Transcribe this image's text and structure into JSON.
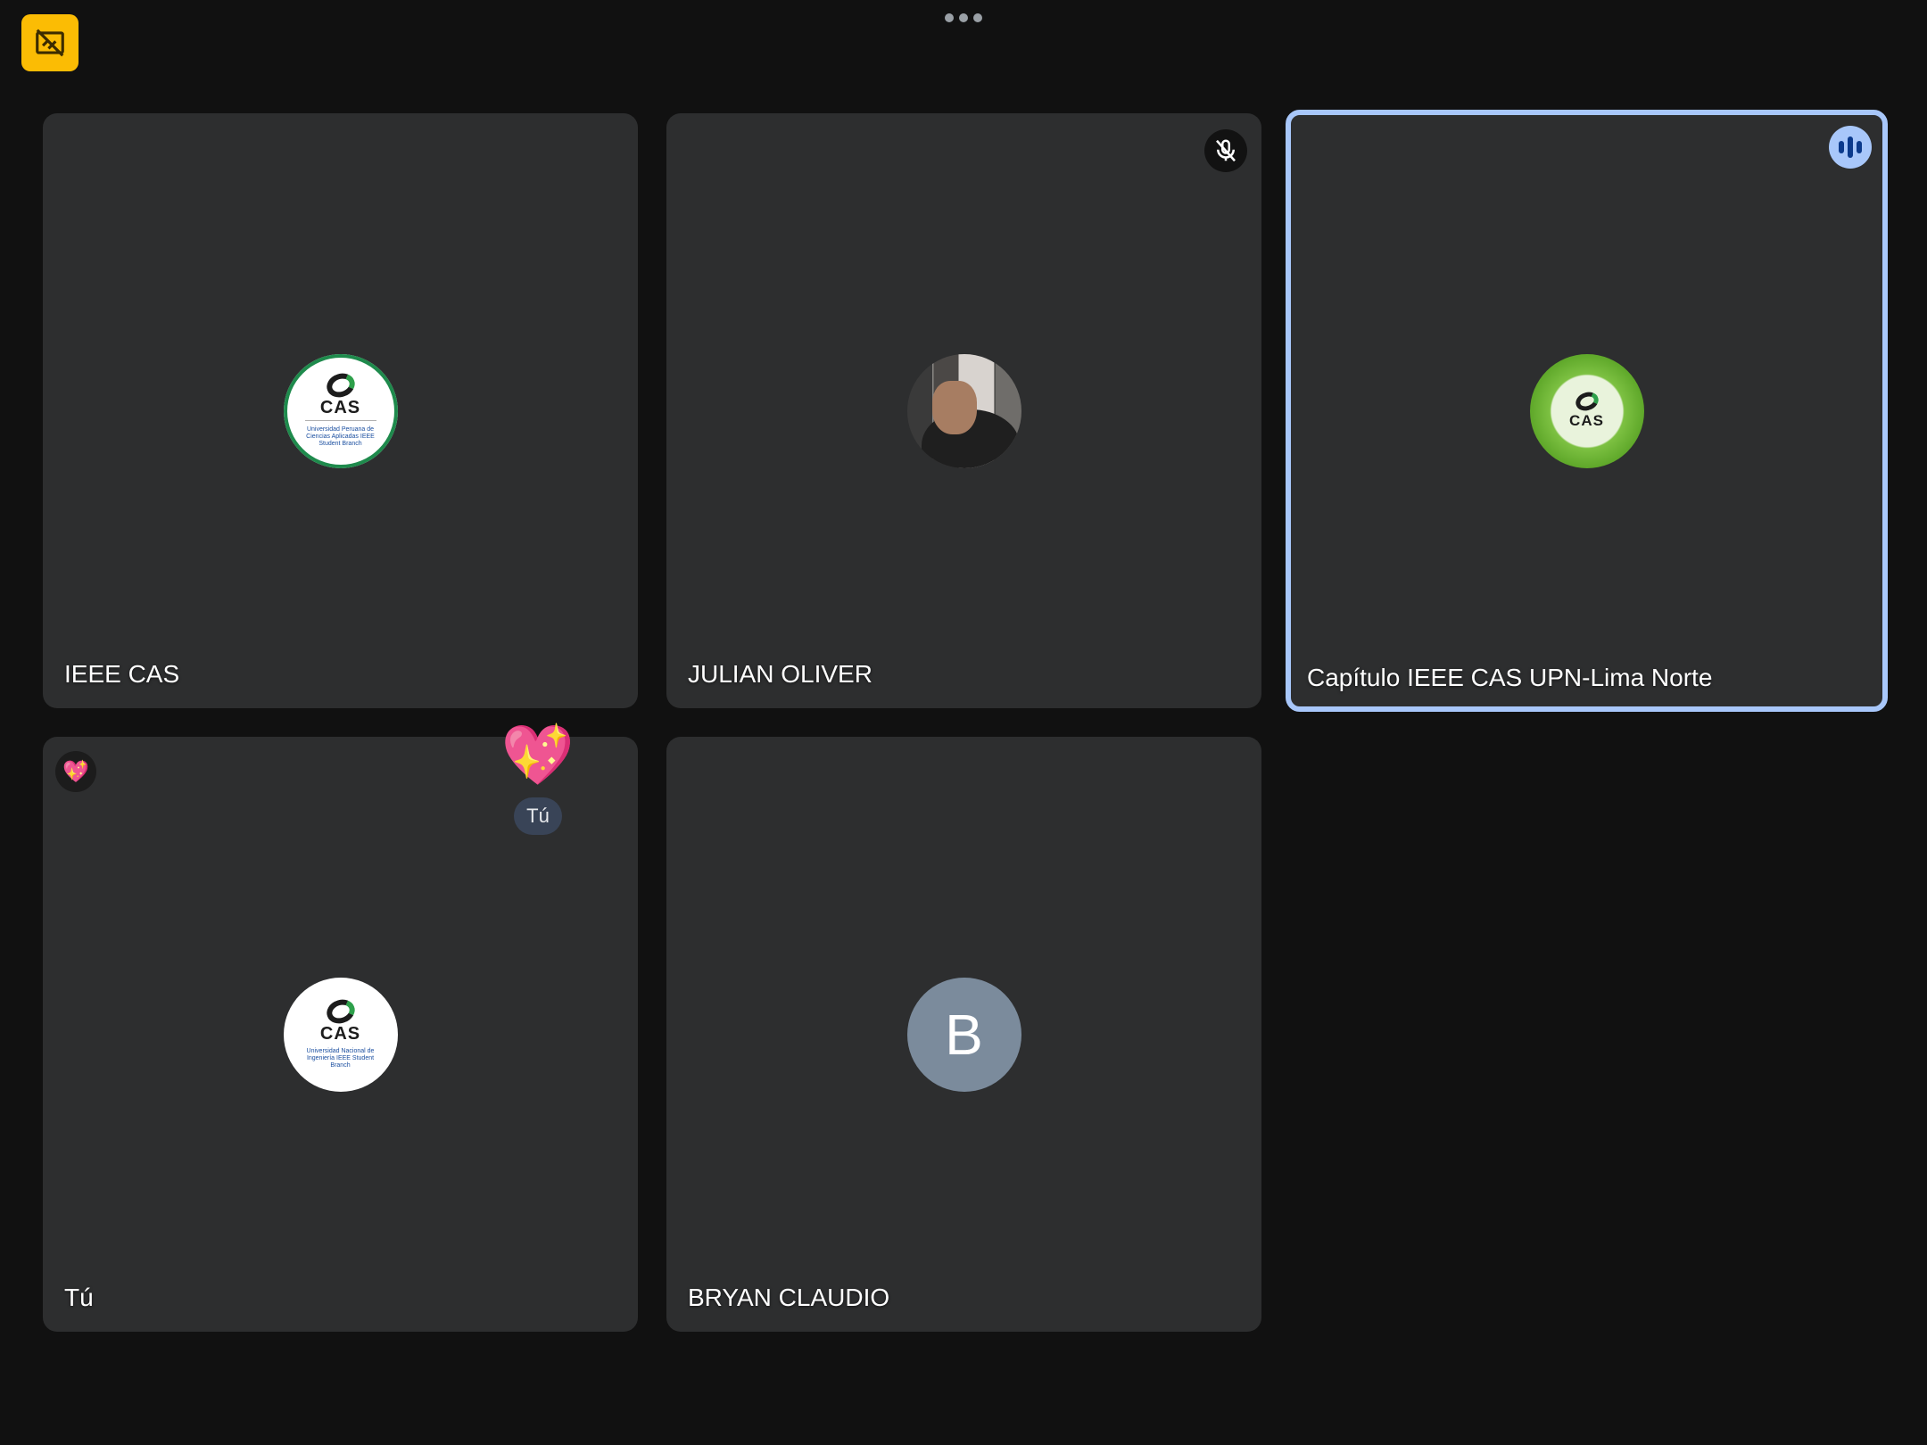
{
  "controls": {
    "top_left_icon": "no-framing-icon",
    "more_icon": "more-options-icon"
  },
  "tiles": [
    {
      "name": "IEEE CAS",
      "avatar_type": "logo",
      "avatar_logo_text": "CAS",
      "avatar_logo_subtext": "Universidad Peruana de Ciencias Aplicadas IEEE Student Branch"
    },
    {
      "name": "JULIAN OLIVER",
      "avatar_type": "photo",
      "status_icon": "mic-off-icon"
    },
    {
      "name": "Capítulo IEEE CAS UPN-Lima Norte",
      "avatar_type": "logo",
      "avatar_logo_text": "CAS",
      "status_icon": "speaking-icon",
      "speaking": true,
      "highlight_color": "#a8c7fa"
    },
    {
      "name": "Tú",
      "avatar_type": "logo",
      "avatar_logo_text": "CAS",
      "avatar_logo_subtext": "Universidad Nacional de Ingeniería IEEE Student Branch",
      "reaction_badge": "💖"
    },
    {
      "name": "BRYAN CLAUDIO",
      "avatar_type": "letter",
      "avatar_letter": "B",
      "avatar_color": "#7b8b9c"
    }
  ],
  "floating_reaction": {
    "emoji": "💖",
    "sender": "Tú"
  },
  "colors": {
    "background": "#111111",
    "tile": "#2d2e2f",
    "accent": "#fbbc04",
    "speaking": "#a8c7fa"
  }
}
